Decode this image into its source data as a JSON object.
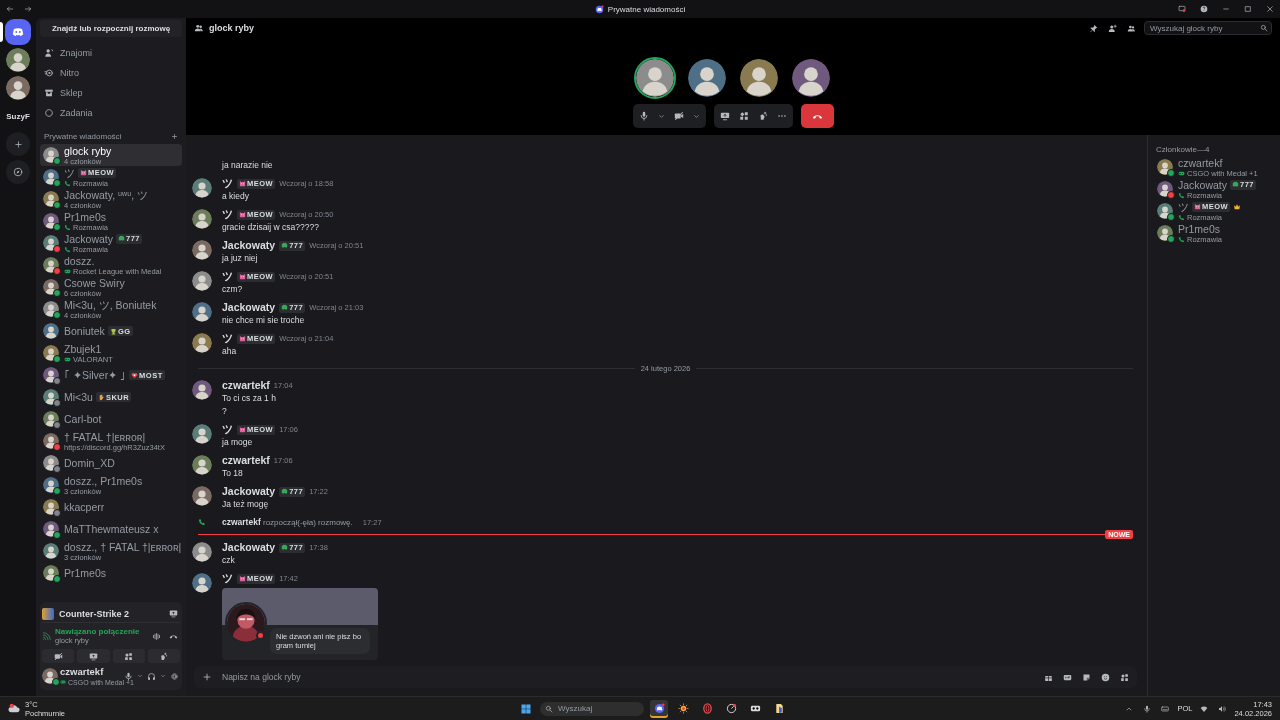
{
  "titlebar": {
    "title": "Prywatne wiadomości"
  },
  "rail": {
    "items": [
      {
        "kind": "home",
        "selected": true
      },
      {
        "kind": "avatar",
        "selected": false
      },
      {
        "kind": "avatar",
        "selected": false
      },
      {
        "kind": "label",
        "text": "SuzyF",
        "selected": false
      },
      {
        "kind": "add",
        "selected": false
      },
      {
        "kind": "explore",
        "selected": false
      }
    ]
  },
  "sidebar": {
    "search_button": "Znajdź lub rozpocznij rozmowę",
    "nav": [
      {
        "kind": "friends",
        "label": "Znajomi"
      },
      {
        "kind": "nitro",
        "label": "Nitro"
      },
      {
        "kind": "shop",
        "label": "Sklep"
      },
      {
        "kind": "quests",
        "label": "Zadania"
      }
    ],
    "section_title": "Prywatne wiadomości",
    "dms": [
      {
        "name": "glock ryby",
        "sub": "4 członków",
        "kind": "group",
        "color": "#23a55a",
        "selected": true
      },
      {
        "name": "ツ",
        "tag": {
          "text": "MEOW",
          "kind": "cat"
        },
        "sub": "Rozmawia",
        "kind": "call",
        "color": "#23a55a",
        "selected": false
      },
      {
        "name": "Jackowaty, ᵘʷᵘ, ツ",
        "sub": "4 członków",
        "kind": "group",
        "color": "#23a55a",
        "selected": false
      },
      {
        "name": "Pr1me0s",
        "sub": "Rozmawia",
        "kind": "call",
        "color": "#23a55a",
        "selected": false
      },
      {
        "name": "Jackowaty",
        "tag": {
          "text": "777",
          "kind": "clover"
        },
        "sub": "Rozmawia",
        "kind": "call",
        "color": "#f23f43",
        "selected": false
      },
      {
        "name": "doszz.",
        "sub": "Rocket League with Medal",
        "kind": "game",
        "color": "#f23f43",
        "selected": false
      },
      {
        "name": "Csowe Swiry",
        "sub": "6 członków",
        "kind": "group",
        "color": "#23a55a",
        "selected": false
      },
      {
        "name": "Mi<3u, ツ, Boniutek",
        "sub": "4 członków",
        "kind": "group",
        "color": "#23a55a",
        "selected": false
      },
      {
        "name": "Boniutek",
        "tag": {
          "text": "GG",
          "kind": "gg"
        },
        "selected": false
      },
      {
        "name": "Zbujek1",
        "sub": "VALORANT",
        "kind": "game",
        "color": "#23a55a",
        "selected": false
      },
      {
        "name": "｢ ✦Silver✦ ｣",
        "tag": {
          "text": "MOST",
          "kind": "heart"
        },
        "color": "#80848e",
        "selected": false
      },
      {
        "name": "Mi<3u",
        "tag": {
          "text": "SKUR",
          "kind": "hand"
        },
        "color": "#80848e",
        "selected": false
      },
      {
        "name": "Carl-bot",
        "color": "#80848e",
        "selected": false
      },
      {
        "name": "† FATAL †|ᴇʀʀᴏʀ|",
        "sub": "https://discord.gg/hR3Zuz34tX",
        "kind": "link",
        "color": "#f23f43",
        "selected": false
      },
      {
        "name": "Domin_XD",
        "color": "#80848e",
        "selected": false
      },
      {
        "name": "doszz., Pr1me0s",
        "sub": "3 członków",
        "kind": "group",
        "color": "#23a55a",
        "selected": false
      },
      {
        "name": "kkacperr",
        "color": "#80848e",
        "selected": false
      },
      {
        "name": "MaTThewmateusz x",
        "color": "#23a55a",
        "selected": false
      },
      {
        "name": "doszz., † FATAL †|ᴇʀʀᴏʀ|",
        "sub": "3 członków",
        "kind": "group",
        "selected": false
      },
      {
        "name": "Pr1me0s",
        "color": "#23a55a",
        "selected": false
      }
    ]
  },
  "voice": {
    "activity": "Counter-Strike 2",
    "status": "Nawiązano połączenie",
    "channel": "glock ryby"
  },
  "user": {
    "name": "czwartekf",
    "activity": "CSGO with Medal +1",
    "color": "#23a55a"
  },
  "header": {
    "channel": "glock ryby",
    "search_placeholder": "Wyszukaj glock ryby"
  },
  "call": {
    "participants": [
      {
        "speaking": true
      },
      {
        "speaking": false
      },
      {
        "speaking": false
      },
      {
        "speaking": false
      }
    ]
  },
  "messages": [
    {
      "kind": "continuation",
      "lines": [
        "ja narazie nie"
      ]
    },
    {
      "kind": "message",
      "author": "ツ",
      "tag": {
        "text": "MEOW",
        "kind": "cat"
      },
      "time": "Wczoraj o 18:58",
      "lines": [
        "a kiedy"
      ]
    },
    {
      "kind": "message",
      "author": "ツ",
      "tag": {
        "text": "MEOW",
        "kind": "cat"
      },
      "time": "Wczoraj o 20:50",
      "lines": [
        "gracie dzisaij w csa?????"
      ]
    },
    {
      "kind": "message",
      "author": "Jackowaty",
      "tag": {
        "text": "777",
        "kind": "clover"
      },
      "time": "Wczoraj o 20:51",
      "lines": [
        "ja juz niej"
      ]
    },
    {
      "kind": "message",
      "author": "ツ",
      "tag": {
        "text": "MEOW",
        "kind": "cat"
      },
      "time": "Wczoraj o 20:51",
      "lines": [
        "czm?"
      ]
    },
    {
      "kind": "message",
      "author": "Jackowaty",
      "tag": {
        "text": "777",
        "kind": "clover"
      },
      "time": "Wczoraj o 21:03",
      "lines": [
        "nie  chce mi sie troche"
      ]
    },
    {
      "kind": "message",
      "author": "ツ",
      "tag": {
        "text": "MEOW",
        "kind": "cat"
      },
      "time": "Wczoraj o 21:04",
      "lines": [
        "aha"
      ]
    },
    {
      "kind": "divider",
      "text": "24 lutego 2026"
    },
    {
      "kind": "message",
      "author": "czwartekf",
      "time": "17:04",
      "lines": [
        "To ci cs za 1 h",
        "?"
      ]
    },
    {
      "kind": "message",
      "author": "ツ",
      "tag": {
        "text": "MEOW",
        "kind": "cat"
      },
      "time": "17:06",
      "lines": [
        "ja moge"
      ]
    },
    {
      "kind": "message",
      "author": "czwartekf",
      "time": "17:06",
      "lines": [
        "To 18"
      ]
    },
    {
      "kind": "message",
      "author": "Jackowaty",
      "tag": {
        "text": "777",
        "kind": "clover"
      },
      "time": "17:22",
      "lines": [
        "Ja też mogę"
      ]
    },
    {
      "kind": "call",
      "text": "**czwartekf** rozpoczął(-ęła) rozmowę.",
      "time": "17:27"
    },
    {
      "kind": "new_marker",
      "text": "NOWE"
    },
    {
      "kind": "message",
      "author": "Jackowaty",
      "tag": {
        "text": "777",
        "kind": "clover"
      },
      "time": "17:38",
      "lines": [
        "czk"
      ]
    },
    {
      "kind": "message",
      "author": "ツ",
      "tag": {
        "text": "MEOW",
        "kind": "cat"
      },
      "time": "17:42",
      "embed": {
        "status_text": "Nie dzwoń ani nie pisz bo gram turniej"
      }
    }
  ],
  "composer": {
    "placeholder": "Napisz na glock ryby"
  },
  "members": {
    "title": "Członkowie—4",
    "items": [
      {
        "name": "czwartekf",
        "sub": "CSGO with Medal +1",
        "kind": "game",
        "color": "#23a55a",
        "owner": false
      },
      {
        "name": "Jackowaty",
        "tag": {
          "text": "777",
          "kind": "clover"
        },
        "sub": "Rozmawia",
        "kind": "call",
        "color": "#f23f43",
        "owner": false
      },
      {
        "name": "ツ",
        "tag": {
          "text": "MEOW",
          "kind": "cat"
        },
        "sub": "Rozmawia",
        "kind": "call",
        "color": "#23a55a",
        "owner": true
      },
      {
        "name": "Pr1me0s",
        "sub": "Rozmawia",
        "kind": "call",
        "color": "#23a55a",
        "owner": false
      }
    ]
  },
  "taskbar": {
    "weather": {
      "temp": "3°C",
      "desc": "Pochmurnie"
    },
    "search_placeholder": "Wyszukaj",
    "apps": [
      {
        "kind": "chat",
        "active": true
      },
      {
        "kind": "sun",
        "active": false
      },
      {
        "kind": "ring",
        "active": false
      },
      {
        "kind": "gauge",
        "active": false
      },
      {
        "kind": "mask",
        "active": false
      },
      {
        "kind": "document",
        "active": false
      }
    ],
    "lang": "POL",
    "time": "17:43",
    "date": "24.02.2026"
  }
}
